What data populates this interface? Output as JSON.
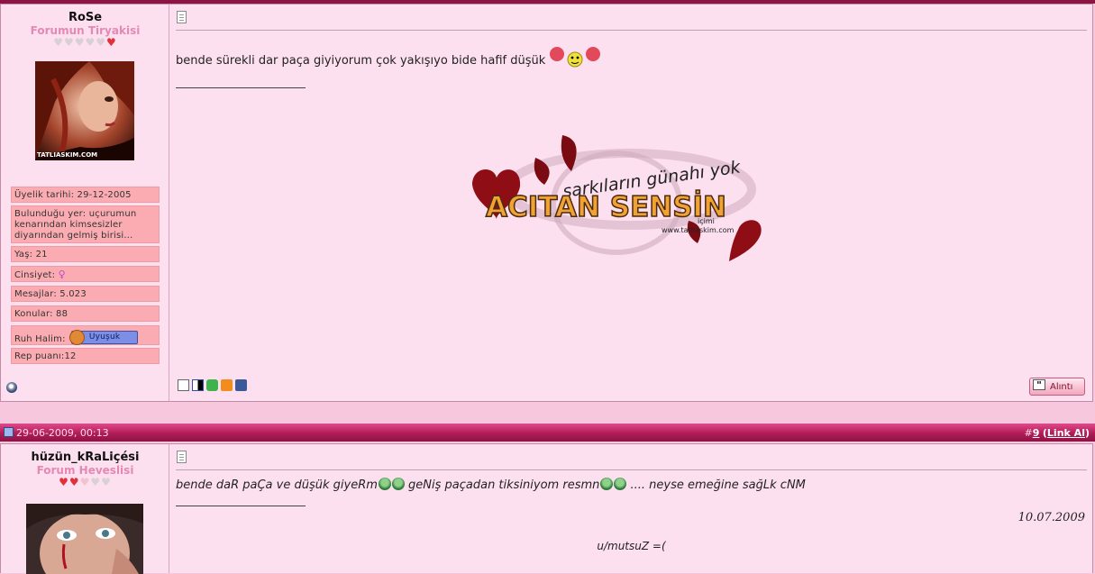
{
  "post1": {
    "user": {
      "name": "RoSe",
      "rank": "Forumun Tiryakisi",
      "rep_hearts": {
        "filled": 1,
        "total": 6
      },
      "avatar_caption": "TATLIASKIM.COM",
      "info": {
        "join_date": "Üyelik tarihi: 29-12-2005",
        "location": "Bulunduğu yer: uçurumun kenarından kimsesizler diyarından gelmiş birisi...",
        "age": "Yaş: 21",
        "gender": "Cinsiyet:",
        "gender_symbol": "♀",
        "messages": "Mesajlar: 5.023",
        "topics": "Konular: 88",
        "mood_label": "Ruh Halim:",
        "mood_value": "Uyuşuk",
        "rep_points": "Rep puanı:12"
      }
    },
    "message": "bende sürekli dar paça giyiyorum çok yakışıyo bide hafif düşük",
    "banner": {
      "line1": "şarkıların günahı yok",
      "line2": "ACITAN SENSİN",
      "line3": "içimi",
      "url": "www.tatliaskim.com"
    },
    "quote_label": "Alıntı"
  },
  "post2_header": {
    "datetime": "29-06-2009, 00:13",
    "post_prefix": "#",
    "post_number": "9",
    "link_open": "(",
    "link_label": "Link Al",
    "link_close": ")"
  },
  "post2": {
    "user": {
      "name": "hüzün_kRaLiçési",
      "rank": "Forum Heveslisi",
      "rep_hearts": {
        "filled": 2,
        "total": 5
      }
    },
    "message_parts": [
      "bende daR paÇa ve düşük giyeRm",
      " geNiş paçadan tiksiniyom resmn",
      " .... neyse emeğine sağLk cNM"
    ],
    "sig_date": "10.07.2009",
    "sig_text": "u/mutsuZ =("
  },
  "colors": {
    "page_bg": "#f7c7de",
    "post_bg": "#fde0f0",
    "info_bg": "#fbacb2",
    "header_bar": "#b01c57",
    "rank_pink": "#e389b4"
  }
}
